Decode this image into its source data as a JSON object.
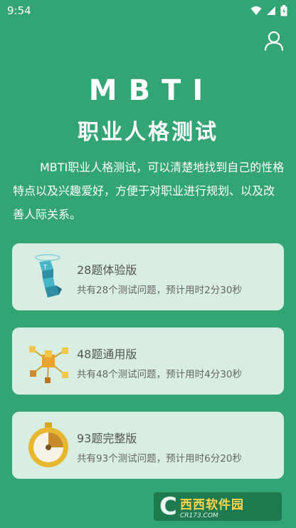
{
  "status": {
    "time": "9:54"
  },
  "header": {
    "title_en": "MBTI",
    "title_cn": "职业人格测试",
    "intro": "MBTI职业人格测试，可以清楚地找到自己的性格特点以及兴趣爱好，方便于对职业进行规划、以及改善人际关系。"
  },
  "cards": [
    {
      "title": "28题体验版",
      "desc": "共有28个测试问题，预计用时2分30秒",
      "icon": "cube-figure-icon"
    },
    {
      "title": "48题通用版",
      "desc": "共有48个测试问题，预计用时4分30秒",
      "icon": "cube-molecule-icon"
    },
    {
      "title": "93题完整版",
      "desc": "共有93个测试问题，预计用时6分20秒",
      "icon": "stopwatch-icon"
    }
  ],
  "watermark": {
    "text_cn": "西西软件园",
    "text_en": "CR173.COM"
  },
  "colors": {
    "background": "#33a574",
    "card": "#d9eee2",
    "accent_yellow": "#f2c230"
  }
}
